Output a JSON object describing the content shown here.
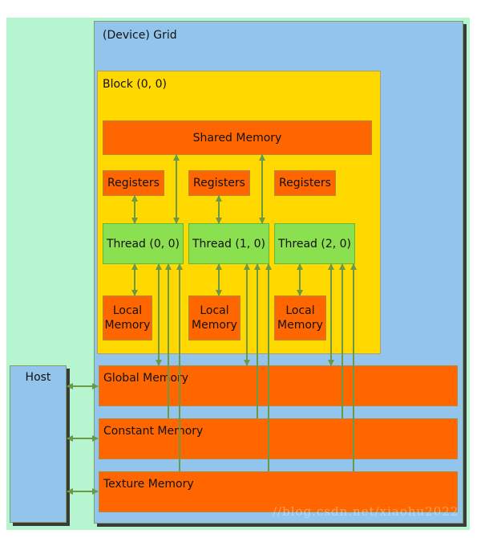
{
  "grid": {
    "label": "(Device) Grid"
  },
  "block": {
    "label": "Block (0, 0)",
    "shared_memory": "Shared Memory",
    "threads": [
      {
        "label": "Thread (0, 0)",
        "registers": "Registers",
        "local": "Local Memory"
      },
      {
        "label": "Thread (1, 0)",
        "registers": "Registers",
        "local": "Local Memory"
      },
      {
        "label": "Thread (2, 0)",
        "registers": "Registers",
        "local": "Local Memory"
      }
    ]
  },
  "memories": {
    "global": "Global Memory",
    "constant": "Constant Memory",
    "texture": "Texture Memory"
  },
  "host": {
    "label": "Host"
  },
  "watermark": "//blog.csdn.net/xiaohu2022",
  "colors": {
    "memory": "#ff6600",
    "thread": "#8ae04f",
    "block": "#ffd800",
    "grid": "#93c5ec",
    "arrow": "#6a9a45"
  }
}
